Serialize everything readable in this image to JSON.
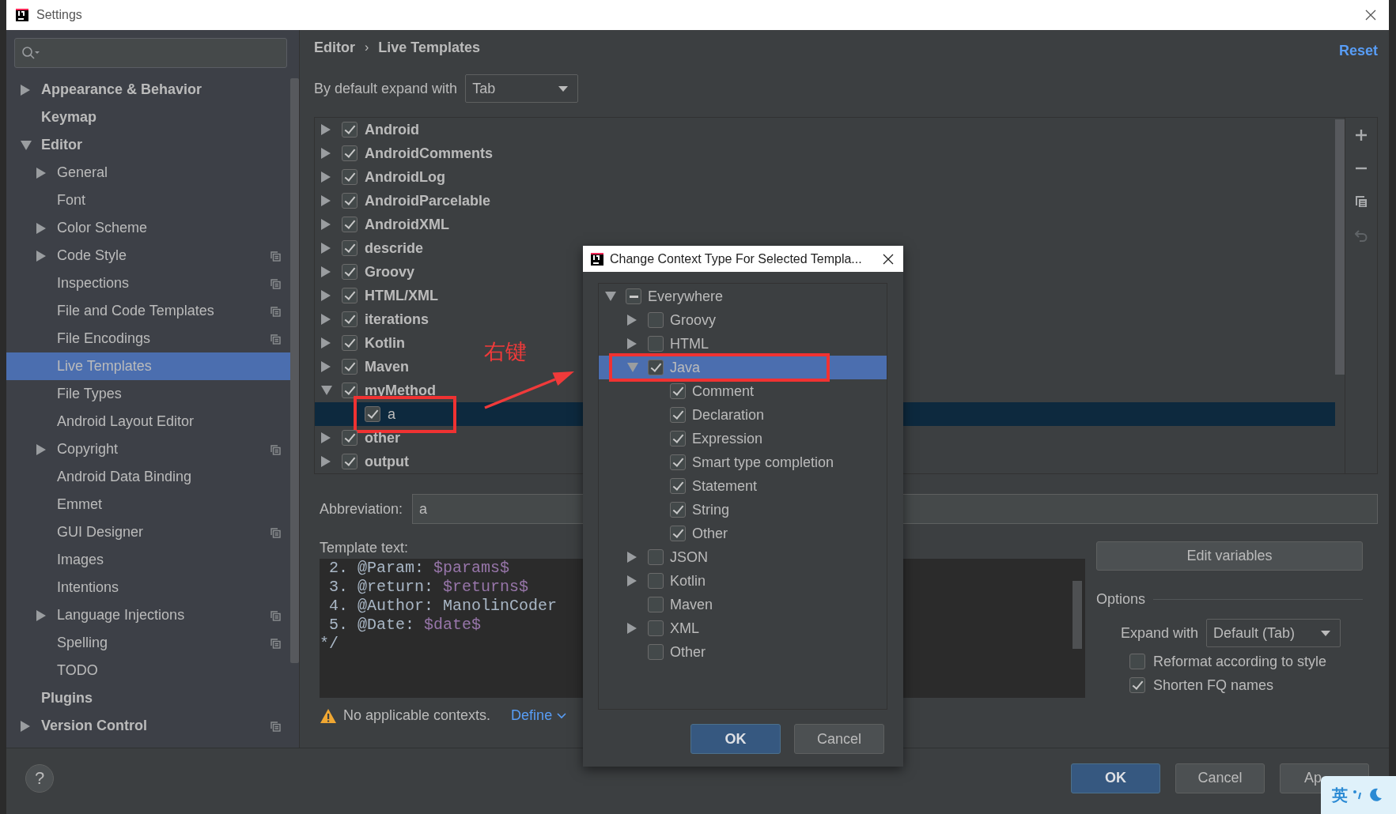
{
  "window": {
    "title": "Settings"
  },
  "sidebar": {
    "items": [
      {
        "label": "Appearance & Behavior",
        "expanded": false,
        "selected": false,
        "scoped": false
      },
      {
        "label": "Keymap",
        "selected": false,
        "scoped": false
      },
      {
        "label": "Editor",
        "expanded": true,
        "selected": false,
        "scoped": false,
        "children": [
          {
            "label": "General",
            "expanded": false,
            "selected": false,
            "scoped": false
          },
          {
            "label": "Font",
            "selected": false,
            "scoped": false
          },
          {
            "label": "Color Scheme",
            "expanded": false,
            "selected": false,
            "scoped": false
          },
          {
            "label": "Code Style",
            "expanded": false,
            "selected": false,
            "scoped": true
          },
          {
            "label": "Inspections",
            "selected": false,
            "scoped": true
          },
          {
            "label": "File and Code Templates",
            "selected": false,
            "scoped": true
          },
          {
            "label": "File Encodings",
            "selected": false,
            "scoped": true
          },
          {
            "label": "Live Templates",
            "selected": true,
            "scoped": false
          },
          {
            "label": "File Types",
            "selected": false,
            "scoped": false
          },
          {
            "label": "Android Layout Editor",
            "selected": false,
            "scoped": false
          },
          {
            "label": "Copyright",
            "expanded": false,
            "selected": false,
            "scoped": true
          },
          {
            "label": "Android Data Binding",
            "selected": false,
            "scoped": false
          },
          {
            "label": "Emmet",
            "selected": false,
            "scoped": false
          },
          {
            "label": "GUI Designer",
            "selected": false,
            "scoped": true
          },
          {
            "label": "Images",
            "selected": false,
            "scoped": false
          },
          {
            "label": "Intentions",
            "selected": false,
            "scoped": false
          },
          {
            "label": "Language Injections",
            "expanded": false,
            "selected": false,
            "scoped": true
          },
          {
            "label": "Spelling",
            "selected": false,
            "scoped": true
          },
          {
            "label": "TODO",
            "selected": false,
            "scoped": false
          }
        ]
      },
      {
        "label": "Plugins",
        "selected": false,
        "scoped": false
      },
      {
        "label": "Version Control",
        "expanded": false,
        "selected": false,
        "scoped": true
      }
    ]
  },
  "breadcrumb": {
    "items": [
      "Editor",
      "Live Templates"
    ],
    "separator": "›"
  },
  "reset_link": "Reset",
  "expand_default": {
    "label": "By default expand with",
    "value": "Tab"
  },
  "templates": [
    {
      "label": "Android",
      "expanded": false,
      "checked": true,
      "selected": false,
      "marked": false
    },
    {
      "label": "AndroidComments",
      "expanded": false,
      "checked": true,
      "selected": false,
      "marked": false
    },
    {
      "label": "AndroidLog",
      "expanded": false,
      "checked": true,
      "selected": false,
      "marked": false
    },
    {
      "label": "AndroidParcelable",
      "expanded": false,
      "checked": true,
      "selected": false,
      "marked": false
    },
    {
      "label": "AndroidXML",
      "expanded": false,
      "checked": true,
      "selected": false,
      "marked": false
    },
    {
      "label": "descride",
      "expanded": false,
      "checked": true,
      "selected": false,
      "marked": false
    },
    {
      "label": "Groovy",
      "expanded": false,
      "checked": true,
      "selected": false,
      "marked": false
    },
    {
      "label": "HTML/XML",
      "expanded": false,
      "checked": true,
      "selected": false,
      "marked": false
    },
    {
      "label": "iterations",
      "expanded": false,
      "checked": true,
      "selected": false,
      "marked": false
    },
    {
      "label": "Kotlin",
      "expanded": false,
      "checked": true,
      "selected": false,
      "marked": false
    },
    {
      "label": "Maven",
      "expanded": false,
      "checked": true,
      "selected": false,
      "marked": false
    },
    {
      "label": "myMethod",
      "expanded": true,
      "checked": true,
      "selected": false,
      "marked": false,
      "children": [
        {
          "label": "a",
          "checked": true,
          "selected": true,
          "marked": true
        }
      ]
    },
    {
      "label": "other",
      "expanded": false,
      "checked": true,
      "selected": false,
      "marked": false
    },
    {
      "label": "output",
      "expanded": false,
      "checked": true,
      "selected": false,
      "marked": false
    }
  ],
  "toolbar": [
    {
      "kind": "add",
      "disabled": false
    },
    {
      "kind": "remove",
      "disabled": false
    },
    {
      "kind": "copy",
      "disabled": false
    },
    {
      "kind": "undo",
      "disabled": true
    }
  ],
  "abbreviation": {
    "label": "Abbreviation:",
    "value": "a"
  },
  "template_text": {
    "label": "Template text:",
    "lines": [
      {
        "text": " 2. @Param: ",
        "variable": "$params$"
      },
      {
        "text": " 3. @return: ",
        "variable": "$returns$"
      },
      {
        "text": " 4. @Author: ManolinCoder"
      },
      {
        "text": " 5. @Date: ",
        "variable": "$date$"
      },
      {
        "text": "*/"
      }
    ]
  },
  "context_warning": {
    "text": "No applicable contexts.",
    "link": "Define"
  },
  "edit_variables_button": "Edit variables",
  "options": {
    "title": "Options",
    "expand_with": {
      "label": "Expand with",
      "value": "Default (Tab)"
    },
    "checkboxes": [
      {
        "label": "Reformat according to style",
        "checked": false
      },
      {
        "label": "Shorten FQ names",
        "checked": true
      }
    ]
  },
  "footer": {
    "help": "?",
    "buttons": [
      {
        "label": "OK",
        "kind": "primary"
      },
      {
        "label": "Cancel",
        "kind": "normal"
      },
      {
        "label": "Ap",
        "kind": "normal"
      }
    ]
  },
  "dialog": {
    "title": "Change Context Type For Selected Templa...",
    "tree": [
      {
        "label": "Everywhere",
        "expanded": true,
        "checked": false,
        "partial": true,
        "selected": false,
        "marked": false,
        "children": [
          {
            "label": "Groovy",
            "expanded": false,
            "checked": false,
            "partial": false,
            "selected": false,
            "marked": false
          },
          {
            "label": "HTML",
            "expanded": false,
            "checked": false,
            "partial": false,
            "selected": false,
            "marked": false
          },
          {
            "label": "Java",
            "expanded": true,
            "checked": true,
            "partial": false,
            "selected": true,
            "marked": true,
            "children": [
              {
                "label": "Comment",
                "checked": true,
                "partial": false,
                "selected": false,
                "marked": false
              },
              {
                "label": "Declaration",
                "checked": true,
                "partial": false,
                "selected": false,
                "marked": false
              },
              {
                "label": "Expression",
                "checked": true,
                "partial": false,
                "selected": false,
                "marked": false
              },
              {
                "label": "Smart type completion",
                "checked": true,
                "partial": false,
                "selected": false,
                "marked": false
              },
              {
                "label": "Statement",
                "checked": true,
                "partial": false,
                "selected": false,
                "marked": false
              },
              {
                "label": "String",
                "checked": true,
                "partial": false,
                "selected": false,
                "marked": false
              },
              {
                "label": "Other",
                "checked": true,
                "partial": false,
                "selected": false,
                "marked": false
              }
            ]
          },
          {
            "label": "JSON",
            "expanded": false,
            "checked": false,
            "partial": false,
            "selected": false,
            "marked": false
          },
          {
            "label": "Kotlin",
            "expanded": false,
            "checked": false,
            "partial": false,
            "selected": false,
            "marked": false
          },
          {
            "label": "Maven",
            "checked": false,
            "partial": false,
            "selected": false,
            "marked": false
          },
          {
            "label": "XML",
            "expanded": false,
            "checked": false,
            "partial": false,
            "selected": false,
            "marked": false
          },
          {
            "label": "Other",
            "checked": false,
            "partial": false,
            "selected": false,
            "marked": false
          }
        ]
      }
    ],
    "buttons": [
      {
        "label": "OK",
        "kind": "primary"
      },
      {
        "label": "Cancel",
        "kind": "normal"
      }
    ]
  },
  "callout": {
    "text": "右键"
  },
  "ime_indicator": {
    "label": "英"
  }
}
